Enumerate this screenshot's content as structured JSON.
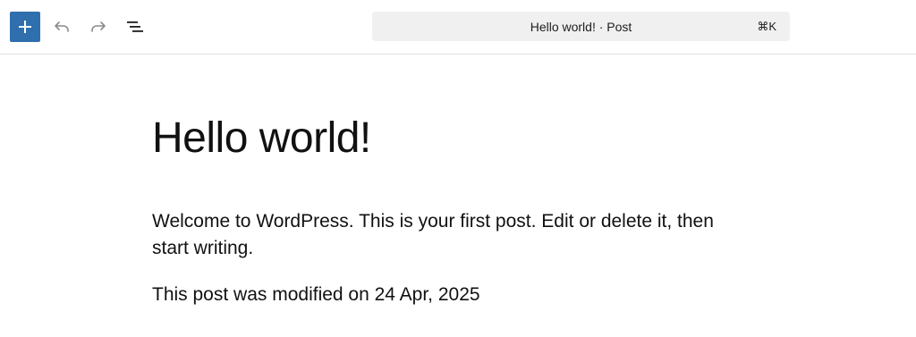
{
  "toolbar": {
    "add_block": {
      "label": "+",
      "color": "#2f6fad",
      "icon": "plus-icon"
    },
    "undo": {
      "icon": "undo-icon"
    },
    "redo": {
      "icon": "redo-icon"
    },
    "document_overview": {
      "icon": "list-view-icon"
    },
    "command_bar": {
      "title": "Hello world! · Post",
      "shortcut": "⌘K"
    }
  },
  "post": {
    "title": "Hello world!",
    "paragraphs": [
      "Welcome to WordPress. This is your first post. Edit or delete it, then start writing.",
      "This post was modified on 24 Apr, 2025"
    ]
  }
}
